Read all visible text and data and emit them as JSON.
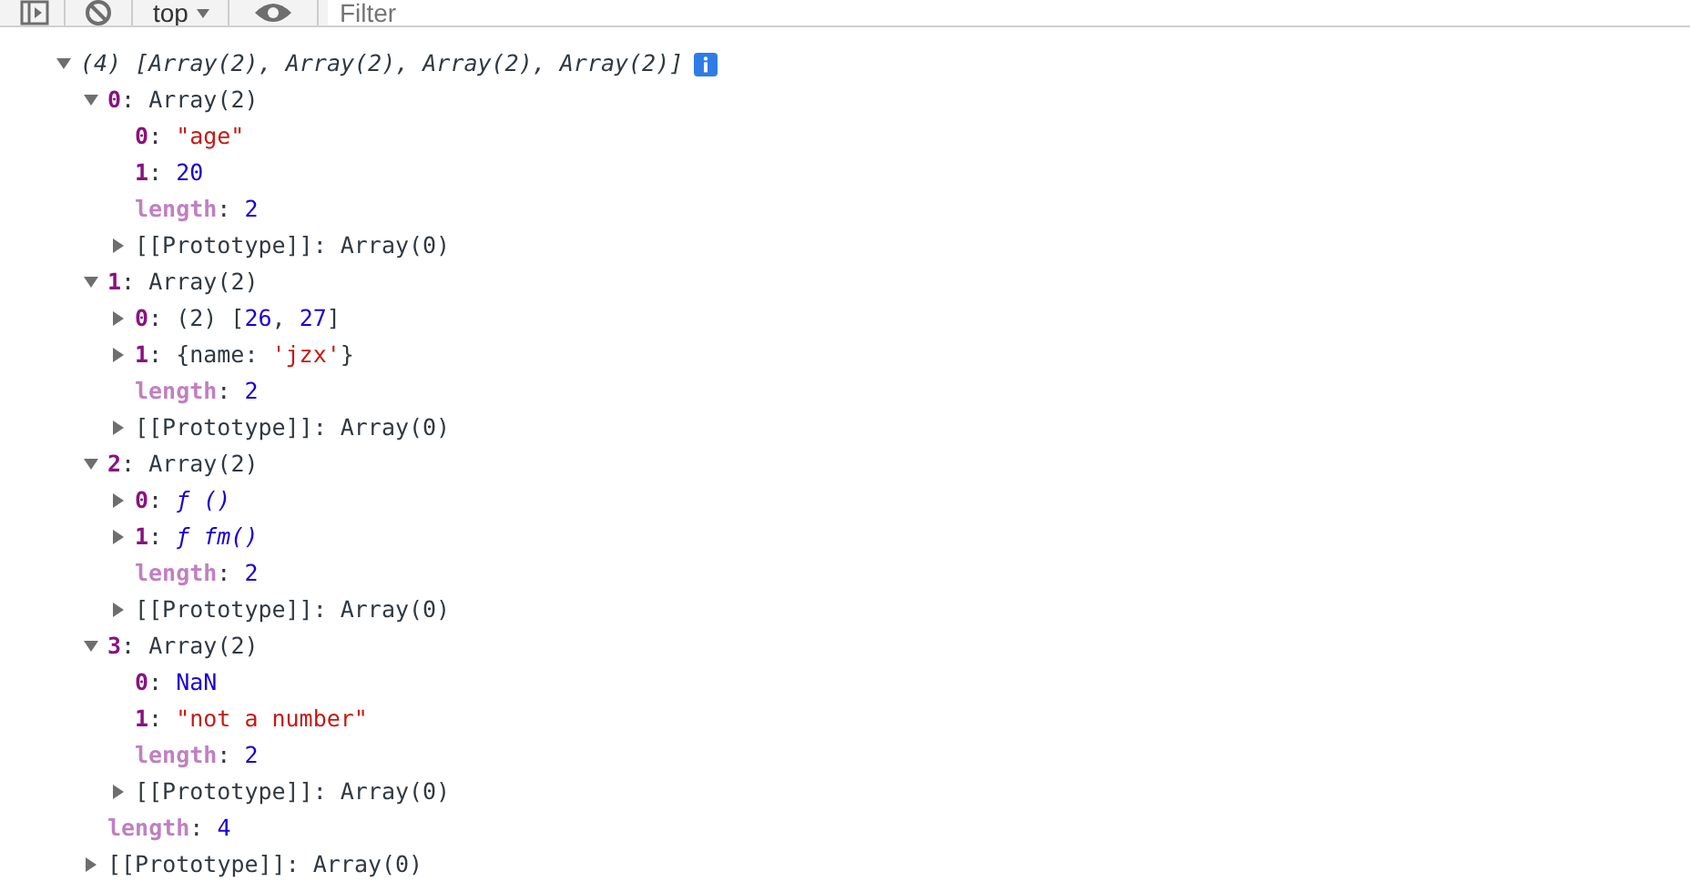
{
  "toolbar": {
    "context": "top",
    "filter": {
      "placeholder": "Filter"
    }
  },
  "root": {
    "value": [
      {
        "text": "(4) [Array(2), Array(2), Array(2), Array(2)]",
        "kind": "summary"
      }
    ],
    "expanded": true,
    "info": true,
    "children": [
      {
        "key": "0:",
        "kind": "index",
        "value": [
          {
            "text": "Array(2)",
            "kind": "plain"
          }
        ],
        "expanded": true,
        "children": [
          {
            "key": "0:",
            "kind": "index",
            "value": [
              {
                "text": "\"age\"",
                "kind": "string"
              }
            ]
          },
          {
            "key": "1:",
            "kind": "index",
            "value": [
              {
                "text": "20",
                "kind": "number"
              }
            ]
          },
          {
            "key": "length:",
            "kind": "meta",
            "value": [
              {
                "text": "2",
                "kind": "number"
              }
            ]
          },
          {
            "key": "[[Prototype]]:",
            "kind": "internal",
            "value": [
              {
                "text": "Array(0)",
                "kind": "plain"
              }
            ],
            "expanded": false
          }
        ]
      },
      {
        "key": "1:",
        "kind": "index",
        "value": [
          {
            "text": "Array(2)",
            "kind": "plain"
          }
        ],
        "expanded": true,
        "children": [
          {
            "key": "0:",
            "kind": "index",
            "value": [
              {
                "text": "(2) [",
                "kind": "plain"
              },
              {
                "text": "26",
                "kind": "number"
              },
              {
                "text": ", ",
                "kind": "plain"
              },
              {
                "text": "27",
                "kind": "number"
              },
              {
                "text": "]",
                "kind": "plain"
              }
            ],
            "expanded": false
          },
          {
            "key": "1:",
            "kind": "index",
            "value": [
              {
                "text": "{name: ",
                "kind": "plain"
              },
              {
                "text": "'jzx'",
                "kind": "string"
              },
              {
                "text": "}",
                "kind": "plain"
              }
            ],
            "expanded": false
          },
          {
            "key": "length:",
            "kind": "meta",
            "value": [
              {
                "text": "2",
                "kind": "number"
              }
            ]
          },
          {
            "key": "[[Prototype]]:",
            "kind": "internal",
            "value": [
              {
                "text": "Array(0)",
                "kind": "plain"
              }
            ],
            "expanded": false
          }
        ]
      },
      {
        "key": "2:",
        "kind": "index",
        "value": [
          {
            "text": "Array(2)",
            "kind": "plain"
          }
        ],
        "expanded": true,
        "children": [
          {
            "key": "0:",
            "kind": "index",
            "value": [
              {
                "text": "ƒ ()",
                "kind": "function"
              }
            ],
            "expanded": false
          },
          {
            "key": "1:",
            "kind": "index",
            "value": [
              {
                "text": "ƒ fm()",
                "kind": "function"
              }
            ],
            "expanded": false
          },
          {
            "key": "length:",
            "kind": "meta",
            "value": [
              {
                "text": "2",
                "kind": "number"
              }
            ]
          },
          {
            "key": "[[Prototype]]:",
            "kind": "internal",
            "value": [
              {
                "text": "Array(0)",
                "kind": "plain"
              }
            ],
            "expanded": false
          }
        ]
      },
      {
        "key": "3:",
        "kind": "index",
        "value": [
          {
            "text": "Array(2)",
            "kind": "plain"
          }
        ],
        "expanded": true,
        "children": [
          {
            "key": "0:",
            "kind": "index",
            "value": [
              {
                "text": "NaN",
                "kind": "number"
              }
            ]
          },
          {
            "key": "1:",
            "kind": "index",
            "value": [
              {
                "text": "\"not a number\"",
                "kind": "string"
              }
            ]
          },
          {
            "key": "length:",
            "kind": "meta",
            "value": [
              {
                "text": "2",
                "kind": "number"
              }
            ]
          },
          {
            "key": "[[Prototype]]:",
            "kind": "internal",
            "value": [
              {
                "text": "Array(0)",
                "kind": "plain"
              }
            ],
            "expanded": false
          }
        ]
      },
      {
        "key": "length:",
        "kind": "meta",
        "value": [
          {
            "text": "4",
            "kind": "number"
          }
        ]
      },
      {
        "key": "[[Prototype]]:",
        "kind": "internal",
        "value": [
          {
            "text": "Array(0)",
            "kind": "plain"
          }
        ],
        "expanded": false
      }
    ]
  }
}
